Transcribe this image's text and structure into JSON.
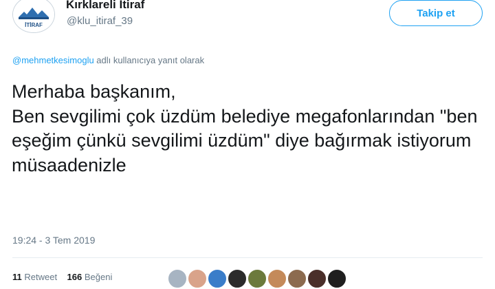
{
  "account": {
    "display_name": "Kırklareli İtiraf",
    "handle": "@klu_itiraf_39",
    "avatar_text": "İTİRAF"
  },
  "follow_button": {
    "label": "Takip et"
  },
  "reply": {
    "mention": "@mehmetkesimoglu",
    "suffix": " adlı kullanıcıya yanıt olarak"
  },
  "tweet": {
    "text": "Merhaba başkanım,\nBen sevgilimi çok üzdüm belediye megafonlarından \"ben eşeğim çünkü sevgilimi üzdüm\" diye bağırmak istiyorum müsaadenizle"
  },
  "timestamp": "19:24 - 3 Tem 2019",
  "stats": {
    "retweet_count": "11",
    "retweet_label": "Retweet",
    "like_count": "166",
    "like_label": "Beğeni"
  },
  "colors": {
    "accent": "#1da1f2",
    "secondary_text": "#657786",
    "liker_avatars": [
      "#a7b4c2",
      "#d9a38a",
      "#3a7dc9",
      "#2b2b2b",
      "#6c7a3c",
      "#c48a5a",
      "#8c6b4f",
      "#4a2f2a",
      "#1f1f1f"
    ]
  }
}
